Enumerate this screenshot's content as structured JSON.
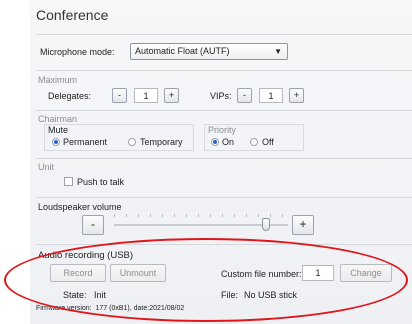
{
  "title": "Conference",
  "microphone": {
    "label": "Microphone mode:",
    "selected": "Automatic Float (AUTF)"
  },
  "maximum": {
    "section_label": "Maximum",
    "delegates_label": "Delegates:",
    "delegates_value": "1",
    "vips_label": "VIPs:",
    "vips_value": "1",
    "minus": "-",
    "plus": "+"
  },
  "chairman": {
    "section_label": "Chairman",
    "mute_label": "Mute",
    "mute_options": [
      "Permanent",
      "Temporary"
    ],
    "mute_selected": "Permanent",
    "priority_label": "Priority",
    "priority_options": [
      "On",
      "Off"
    ],
    "priority_selected": "On"
  },
  "unit": {
    "section_label": "Unit",
    "push_to_talk": "Push to talk",
    "push_to_talk_checked": false
  },
  "loudspeaker": {
    "section_label": "Loudspeaker volume",
    "minus": "-",
    "plus": "+",
    "level": 0.85
  },
  "audio": {
    "section_label": "Audio recording (USB)",
    "record": "Record",
    "unmount": "Unmount",
    "custom_label": "Custom file number:",
    "custom_value": "1",
    "change": "Change",
    "state_label": "State:",
    "state_value": "Init",
    "file_label": "File:",
    "file_value": "No USB stick"
  },
  "firmware": "Firmware version:  177 (0xB1), date:2021/08/02",
  "highlight_color": "#e0161a"
}
